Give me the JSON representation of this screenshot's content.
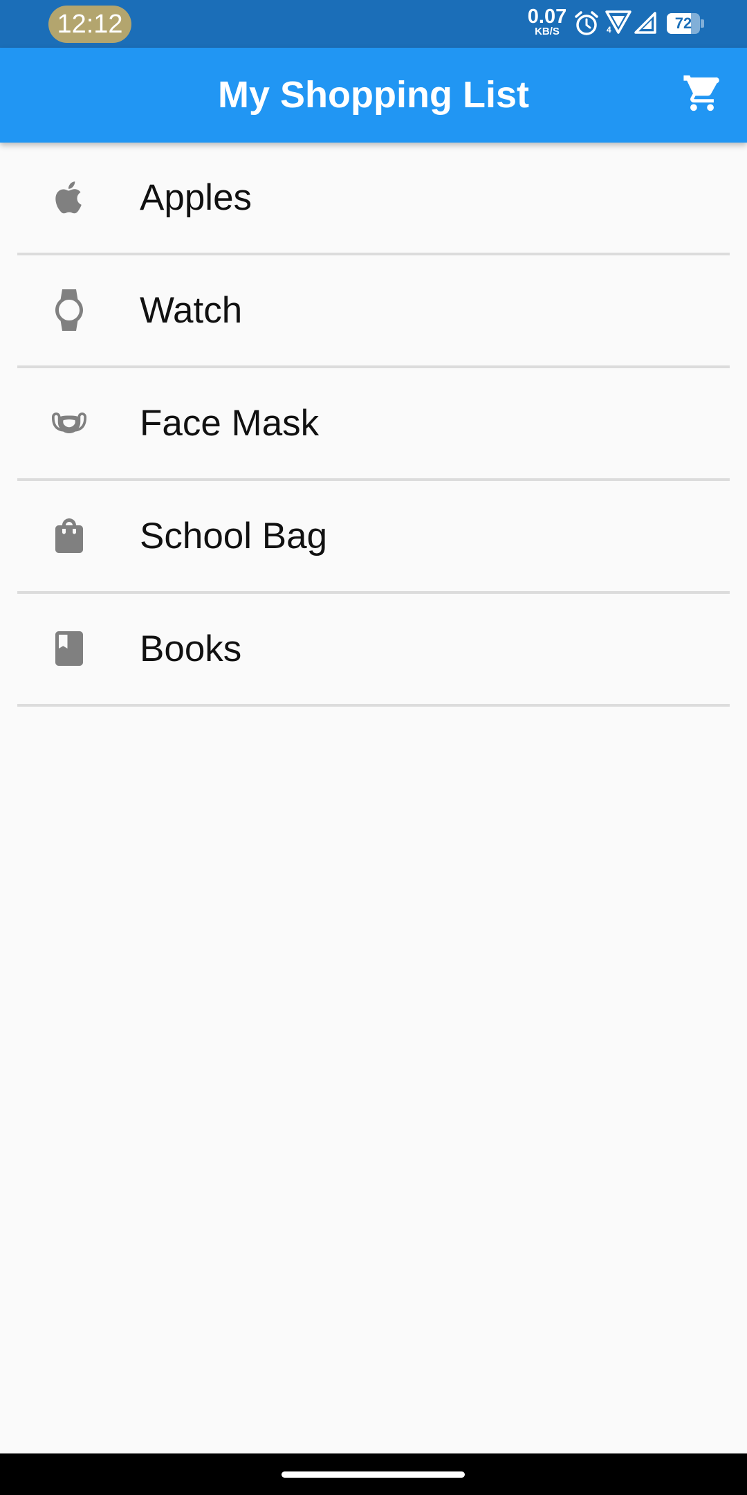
{
  "status_bar": {
    "time": "12:12",
    "net_speed_value": "0.07",
    "net_speed_unit": "KB/S",
    "network_type": "4",
    "battery_level": "72",
    "battery_fraction": 0.72,
    "icons": [
      "alarm-icon",
      "signal-icon",
      "signal-icon",
      "battery-icon"
    ]
  },
  "app_bar": {
    "title": "My Shopping List",
    "action_icon": "shopping-cart-icon"
  },
  "items": [
    {
      "label": "Apples",
      "icon": "apple-icon"
    },
    {
      "label": "Watch",
      "icon": "watch-icon"
    },
    {
      "label": "Face Mask",
      "icon": "face-mask-icon"
    },
    {
      "label": "School Bag",
      "icon": "shopping-bag-icon"
    },
    {
      "label": "Books",
      "icon": "book-icon"
    }
  ],
  "colors": {
    "status_bar": "#1b6eb8",
    "app_bar": "#2196f3",
    "icon_grey": "#808080",
    "divider": "#dcdcdc",
    "background": "#fafafa",
    "time_pill": "#b3a56e"
  }
}
